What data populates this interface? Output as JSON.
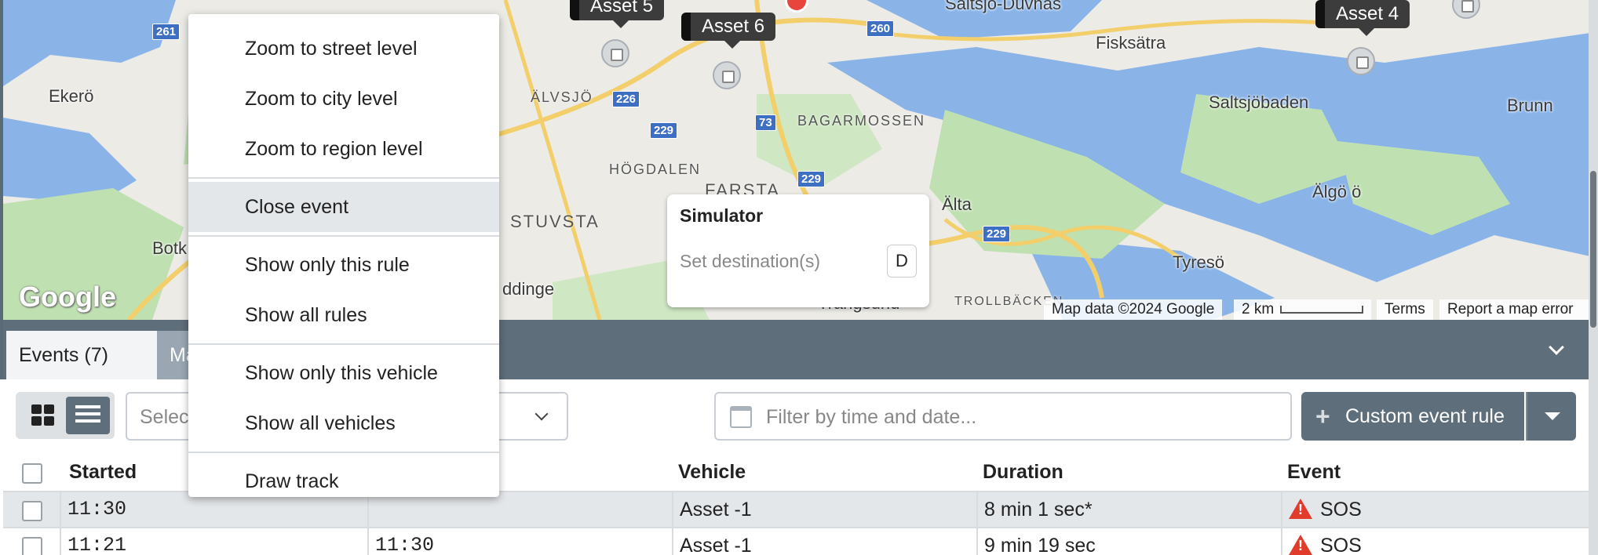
{
  "map": {
    "places": [
      {
        "name": "Ekerö"
      },
      {
        "name": "Fisksätra"
      },
      {
        "name": "Saltsjöbaden"
      },
      {
        "name": "Brunn"
      },
      {
        "name": "Älgö ö"
      },
      {
        "name": "Tyresö"
      },
      {
        "name": "Älta"
      },
      {
        "name": "Botk"
      },
      {
        "name": "ddinge"
      },
      {
        "name": "Saltsjö-Duvnäs"
      },
      {
        "name": "Trångsund"
      }
    ],
    "districts": [
      "ÄLVSJÖ",
      "BAGARMOSSEN",
      "HÖGDALEN",
      "FARSTA",
      "STUVSTA",
      "TROLLBÄCKEN"
    ],
    "roads": [
      "261",
      "260",
      "226",
      "229",
      "73",
      "229",
      "229"
    ],
    "assets": [
      "Asset 5",
      "Asset 6",
      "Asset 4"
    ],
    "attribution": "Map data ©2024 Google",
    "scale": "2 km",
    "terms": "Terms",
    "report": "Report a map error",
    "logo": "Google"
  },
  "simulator": {
    "title": "Simulator",
    "destination_placeholder": "Set destination(s)",
    "shortcut": "D"
  },
  "context_menu": {
    "items": [
      "Zoom to street level",
      "Zoom to city level",
      "Zoom to region level",
      "Close event",
      "Show only this rule",
      "Show all rules",
      "Show only this vehicle",
      "Show all vehicles",
      "Draw track"
    ]
  },
  "panel": {
    "tabs": [
      "Events (7)",
      "Ma"
    ]
  },
  "toolbar": {
    "select_placeholder": "Selec",
    "date_placeholder": "Filter by time and date...",
    "custom_rule_label": "Custom event rule"
  },
  "table": {
    "columns": [
      "Started",
      "",
      "Vehicle",
      "Duration",
      "Event"
    ],
    "rows": [
      {
        "started": "11:30",
        "ended": "",
        "vehicle": "Asset -1",
        "duration": "8 min 1 sec*",
        "event": "SOS"
      },
      {
        "started": "11:21",
        "ended": "11:30",
        "vehicle": "Asset -1",
        "duration": "9 min 19 sec",
        "event": "SOS"
      }
    ]
  },
  "colors": {
    "panel_header": "#5e6e7a",
    "warning": "#e03b2b",
    "water": "#8ab4e8",
    "green": "#bfe0b1"
  }
}
